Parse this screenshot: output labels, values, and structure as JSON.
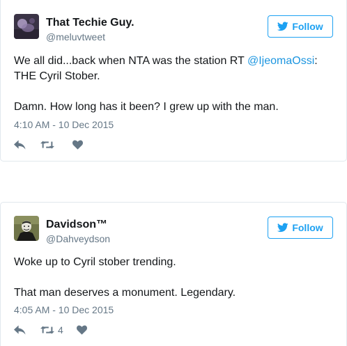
{
  "tweets": [
    {
      "display_name": "That Techie Guy.",
      "handle": "@meluvtweet",
      "follow_label": "Follow",
      "text_part1": "We all did...back when NTA was the station RT ",
      "mention": "@IjeomaOssi",
      "text_part2": ":",
      "text_line2": "THE Cyril Stober.",
      "text_para2": "Damn. How long has it been? I grew up with the man.",
      "timestamp": "4:10 AM - 10 Dec 2015",
      "retweet_count": "",
      "icons": [
        "reply-icon",
        "retweet-icon",
        "like-heart-icon",
        "twitter-bird-icon"
      ]
    },
    {
      "display_name": "Davidson™",
      "handle": "@Dahveydson",
      "follow_label": "Follow",
      "text_para1": "Woke up to Cyril stober trending.",
      "text_para2": "That man deserves a monument. Legendary.",
      "timestamp": "4:05 AM - 10 Dec 2015",
      "retweet_count": "4",
      "icons": [
        "reply-icon",
        "retweet-icon",
        "like-heart-icon",
        "twitter-bird-icon"
      ]
    }
  ],
  "colors": {
    "accent": "#1da1f2",
    "link": "#1b95e0",
    "secondary_text": "#657786",
    "icon_gray": "#657786",
    "border": "#e1e8ed"
  }
}
